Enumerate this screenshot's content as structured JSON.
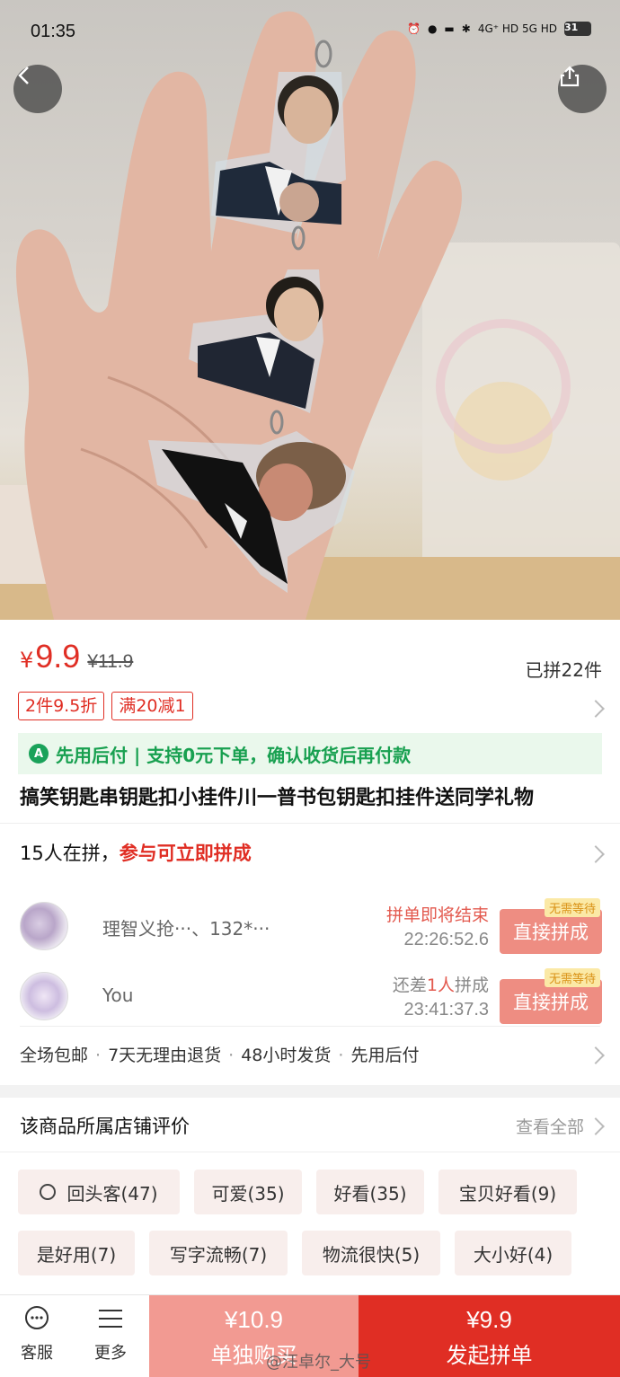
{
  "status_bar": {
    "time": "01:35",
    "network": "4G⁺ HD  5G HD",
    "battery": "31"
  },
  "product": {
    "yen": "¥",
    "price": "9.9",
    "original_price": "¥11.9",
    "sold": "已拼22件",
    "promos": [
      "2件9.5折",
      "满20减1"
    ],
    "pay_later_badge": "A",
    "pay_later": "先用后付 | 支持0元下单，确认收货后再付款",
    "title": "搞笑钥匙串钥匙扣小挂件川一普书包钥匙扣挂件送同学礼物"
  },
  "group": {
    "count_text": "15人在拼，",
    "count_highlight": "参与可立即拼成",
    "rows": [
      {
        "name": "理智义抢···、132*···",
        "status_a": "拼单即将结束",
        "status_b": "",
        "status_c": "",
        "timer": "22:26:52.6",
        "tag": "无需等待",
        "button": "直接拼成"
      },
      {
        "name": "You",
        "status_a": "还差",
        "status_b": "1人",
        "status_c": "拼成",
        "timer": "23:41:37.3",
        "tag": "无需等待",
        "button": "直接拼成"
      }
    ]
  },
  "services": [
    "全场包邮",
    "7天无理由退货",
    "48小时发货",
    "先用后付"
  ],
  "reviews": {
    "title": "该商品所属店铺评价",
    "view_all": "查看全部",
    "tags": [
      "回头客(47)",
      "可爱(35)",
      "好看(35)",
      "宝贝好看(9)",
      "是好用(7)",
      "写字流畅(7)",
      "物流很快(5)",
      "大小好(4)"
    ]
  },
  "bottom_bar": {
    "service_label": "客服",
    "more_label": "更多",
    "solo_price": "¥10.9",
    "solo_label": "单独购买",
    "group_price": "¥9.9",
    "group_label": "发起拼单"
  },
  "watermark": "@汪卓尔_大号",
  "colors": {
    "accent": "#e02e24",
    "accent_light": "#f29a92",
    "green": "#18a050"
  }
}
